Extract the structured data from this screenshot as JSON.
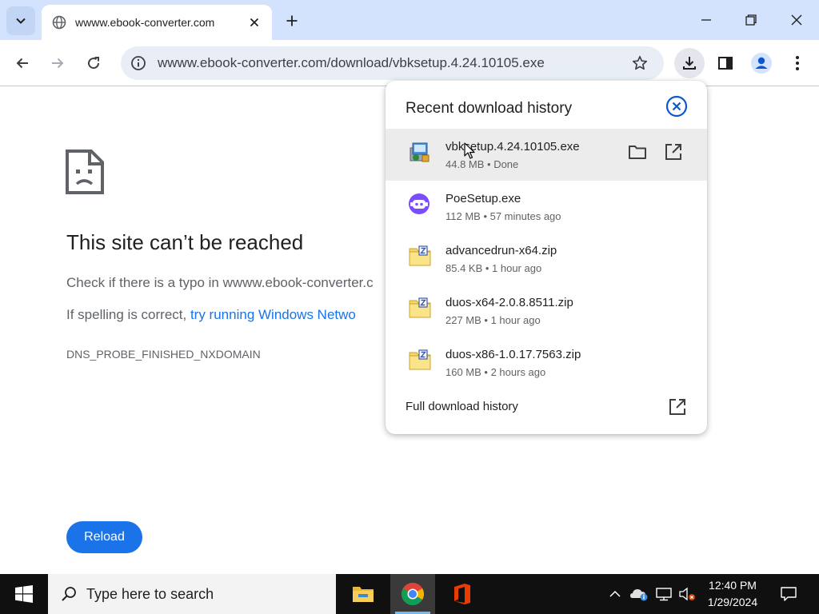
{
  "browser": {
    "tab_title": "wwww.ebook-converter.com",
    "url": "wwww.ebook-converter.com/download/vbksetup.4.24.10105.exe"
  },
  "error_page": {
    "title": "This site can’t be reached",
    "line1": "Check if there is a typo in wwww.ebook-converter.c",
    "line2_prefix": "If spelling is correct, ",
    "line2_link": "try running Windows Netwo",
    "error_code": "DNS_PROBE_FINISHED_NXDOMAIN",
    "reload_label": "Reload"
  },
  "downloads": {
    "title": "Recent download history",
    "items": [
      {
        "name": "vbksetup.4.24.10105.exe",
        "meta": "44.8 MB • Done",
        "icon": "installer-icon"
      },
      {
        "name": "PoeSetup.exe",
        "meta": "112 MB • 57 minutes ago",
        "icon": "poe-app-icon"
      },
      {
        "name": "advancedrun-x64.zip",
        "meta": "85.4 KB • 1 hour ago",
        "icon": "zip-folder-icon"
      },
      {
        "name": "duos-x64-2.0.8.8511.zip",
        "meta": "227 MB • 1 hour ago",
        "icon": "zip-folder-icon"
      },
      {
        "name": "duos-x86-1.0.17.7563.zip",
        "meta": "160 MB • 2 hours ago",
        "icon": "zip-folder-icon"
      }
    ],
    "full_history_label": "Full download history"
  },
  "taskbar": {
    "search_placeholder": "Type here to search",
    "time": "12:40 PM",
    "date": "1/29/2024"
  },
  "colors": {
    "tabstrip": "#d3e3fd",
    "accent_blue": "#1a73e8",
    "taskbar": "#101010"
  }
}
